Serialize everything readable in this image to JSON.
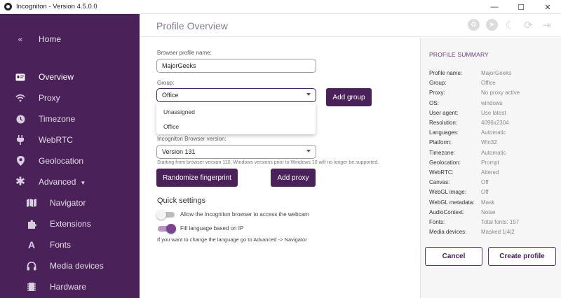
{
  "window": {
    "title": "Incogniton - Version 4.5.0.0",
    "minimize": "—",
    "maximize": "☐",
    "close": "✕"
  },
  "sidebar": {
    "home": "Home",
    "overview": "Overview",
    "proxy": "Proxy",
    "timezone": "Timezone",
    "webrtc": "WebRTC",
    "geolocation": "Geolocation",
    "advanced": "Advanced",
    "navigator": "Navigator",
    "extensions": "Extensions",
    "fonts": "Fonts",
    "media_devices": "Media devices",
    "hardware": "Hardware"
  },
  "header": {
    "title": "Profile Overview"
  },
  "form": {
    "profile_name_label": "Browser profile name:",
    "profile_name_value": "MajorGeeks",
    "group_label": "Group:",
    "group_value": "Office",
    "add_group": "Add group",
    "group_options": [
      "Unassigned",
      "Office"
    ],
    "browser_version_label": "Incogniton Browser version:",
    "browser_version_value": "Version 131",
    "version_note": "Starting from browser version 110, Windows versions prior to Windows 10 will no longer be supported.",
    "randomize": "Randomize fingerprint",
    "add_proxy": "Add proxy",
    "quick_settings": "Quick settings",
    "webcam_label": "Allow the Incogniton browser to access the webcam",
    "webcam_on": false,
    "language_label": "Fill language based on IP",
    "language_on": true,
    "language_note": "If you want to change the language go to Advanced -> Navigator"
  },
  "summary": {
    "title": "PROFILE SUMMARY",
    "rows": [
      {
        "k": "Profile name:",
        "v": "MajorGeeks"
      },
      {
        "k": "Group:",
        "v": "Office"
      },
      {
        "k": "Proxy:",
        "v": "No proxy active"
      },
      {
        "k": "OS:",
        "v": "windows"
      },
      {
        "k": "User agent:",
        "v": "Use latest"
      },
      {
        "k": "Resolution:",
        "v": "4096x2304"
      },
      {
        "k": "Languages:",
        "v": "Automatic"
      },
      {
        "k": "Platform:",
        "v": "Win32"
      },
      {
        "k": "Timezone:",
        "v": "Automatic"
      },
      {
        "k": "Geolocation:",
        "v": "Prompt"
      },
      {
        "k": "WebRTC:",
        "v": "Altered"
      },
      {
        "k": "Canvas:",
        "v": "Off"
      },
      {
        "k": "WebGL image:",
        "v": "Off"
      },
      {
        "k": "WebGL metadata:",
        "v": "Mask"
      },
      {
        "k": "AudioContext:",
        "v": "Noise"
      },
      {
        "k": "Fonts:",
        "v": "Total fonts: 157"
      },
      {
        "k": "Media devices:",
        "v": "Masked 1|4|2"
      }
    ],
    "cancel": "Cancel",
    "create": "Create profile"
  },
  "colors": {
    "accent": "#4a2259",
    "sidebar_bg": "#4a2259",
    "toggle_on": "#8e5aa3"
  }
}
